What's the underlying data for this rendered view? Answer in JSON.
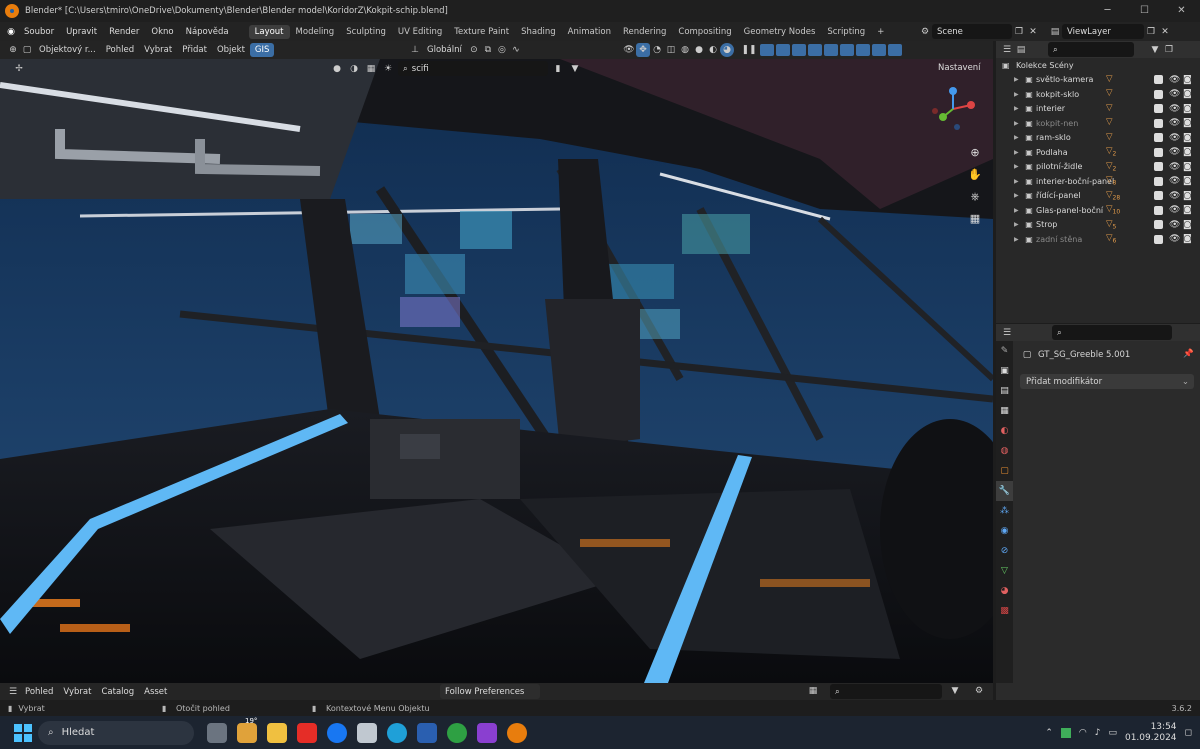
{
  "window": {
    "title": "Blender* [C:\\Users\\tmiro\\OneDrive\\Dokumenty\\Blender\\Blender model\\KoridorZ\\Kokpit-schip.blend]"
  },
  "menu": [
    "Soubor",
    "Upravit",
    "Render",
    "Okno",
    "Nápověda"
  ],
  "workspaces": [
    {
      "label": "Layout",
      "active": true
    },
    {
      "label": "Modeling"
    },
    {
      "label": "Sculpting"
    },
    {
      "label": "UV Editing"
    },
    {
      "label": "Texture Paint"
    },
    {
      "label": "Shading"
    },
    {
      "label": "Animation"
    },
    {
      "label": "Rendering"
    },
    {
      "label": "Compositing"
    },
    {
      "label": "Geometry Nodes"
    },
    {
      "label": "Scripting"
    }
  ],
  "scene": {
    "name": "Scene",
    "view_layer": "ViewLayer"
  },
  "viewport_header": {
    "mode": "Objektový r...",
    "menus": [
      "Pohled",
      "Vybrat",
      "Přidat",
      "Objekt",
      "GIS"
    ],
    "orientation": "Globální",
    "search_value": "scifi",
    "options_label": "Nastavení"
  },
  "outliner": {
    "root": "Kolekce Scény",
    "items": [
      {
        "name": "světlo-kamera",
        "extra": "",
        "dim": false
      },
      {
        "name": "kokpit-sklo",
        "extra": "",
        "dim": false
      },
      {
        "name": "interier",
        "extra": "",
        "dim": false
      },
      {
        "name": "kokpit-nen",
        "extra": "",
        "dim": true
      },
      {
        "name": "ram-sklo",
        "extra": "",
        "dim": false
      },
      {
        "name": "Podlaha",
        "extra": "2",
        "dim": false
      },
      {
        "name": "pilotní-židle",
        "extra": "2",
        "dim": false
      },
      {
        "name": "interier-boční-panel",
        "extra": "8",
        "dim": false
      },
      {
        "name": "řídící-panel",
        "extra": "28",
        "dim": false
      },
      {
        "name": "Glas-panel-boční",
        "extra": "10",
        "dim": false
      },
      {
        "name": "Strop",
        "extra": "5",
        "dim": false
      },
      {
        "name": "zadní stěna",
        "extra": "6",
        "dim": true
      }
    ]
  },
  "properties": {
    "object_name": "GT_SG_Greeble 5.001",
    "add_modifier": "Přidat modifikátor"
  },
  "asset_bar": {
    "menus": [
      "Pohled",
      "Vybrat",
      "Catalog",
      "Asset"
    ],
    "follow": "Follow Preferences"
  },
  "status": {
    "left": "Vybrat",
    "middle": "Otočit pohled",
    "right": "Kontextové Menu Objektu",
    "version": "3.6.2"
  },
  "taskbar": {
    "search": "Hledat",
    "time": "13:54",
    "date": "01.09.2024",
    "weather": "19°"
  },
  "colors": {
    "accent": "#3b6ea5",
    "orange": "#e19a4a",
    "neon": "#5fb8f5"
  }
}
